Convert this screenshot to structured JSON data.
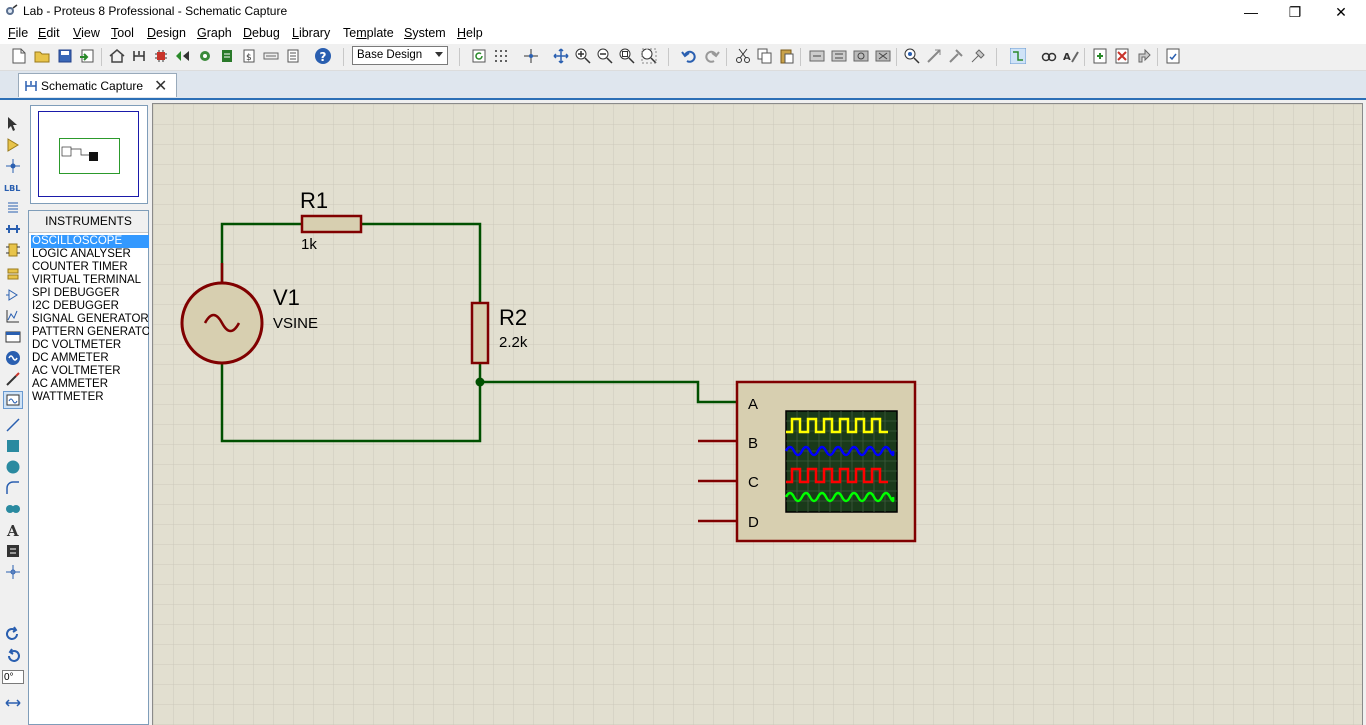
{
  "window": {
    "title": "Lab - Proteus 8 Professional - Schematic Capture",
    "minimize_glyph": "—",
    "maximize_glyph": "❐",
    "close_glyph": "✕"
  },
  "menu": {
    "items": [
      "File",
      "Edit",
      "View",
      "Tool",
      "Design",
      "Graph",
      "Debug",
      "Library",
      "Template",
      "System",
      "Help"
    ],
    "underlines": [
      "F",
      "E",
      "V",
      "T",
      "D",
      "G",
      "D",
      "L",
      "m",
      "S",
      "H"
    ]
  },
  "toolbar": {
    "variant_select": "Base Design"
  },
  "tabs": [
    {
      "label": "Schematic Capture",
      "close_glyph": "✕"
    }
  ],
  "device_panel": {
    "header": "INSTRUMENTS",
    "items": [
      "OSCILLOSCOPE",
      "LOGIC ANALYSER",
      "COUNTER TIMER",
      "VIRTUAL TERMINAL",
      "SPI DEBUGGER",
      "I2C DEBUGGER",
      "SIGNAL GENERATOR",
      "PATTERN GENERATO",
      "DC VOLTMETER",
      "DC AMMETER",
      "AC VOLTMETER",
      "AC AMMETER",
      "WATTMETER"
    ],
    "selected": "OSCILLOSCOPE"
  },
  "rotation": {
    "value": "0°"
  },
  "schematic": {
    "r1": {
      "ref": "R1",
      "value": "1k"
    },
    "r2": {
      "ref": "R2",
      "value": "2.2k"
    },
    "v1": {
      "ref": "V1",
      "value": "VSINE"
    },
    "scope": {
      "channels": [
        "A",
        "B",
        "C",
        "D"
      ]
    }
  },
  "colors": {
    "wire": "#005000",
    "component": "#800000",
    "component_fill": "#d7cfb0",
    "sheet_bg": "#e2dfd0",
    "grid": "#c7c4b6",
    "scope_trace_a": "#ffff00",
    "scope_trace_b": "#0000ff",
    "scope_trace_c": "#ff0000",
    "scope_trace_d": "#00ff00"
  }
}
